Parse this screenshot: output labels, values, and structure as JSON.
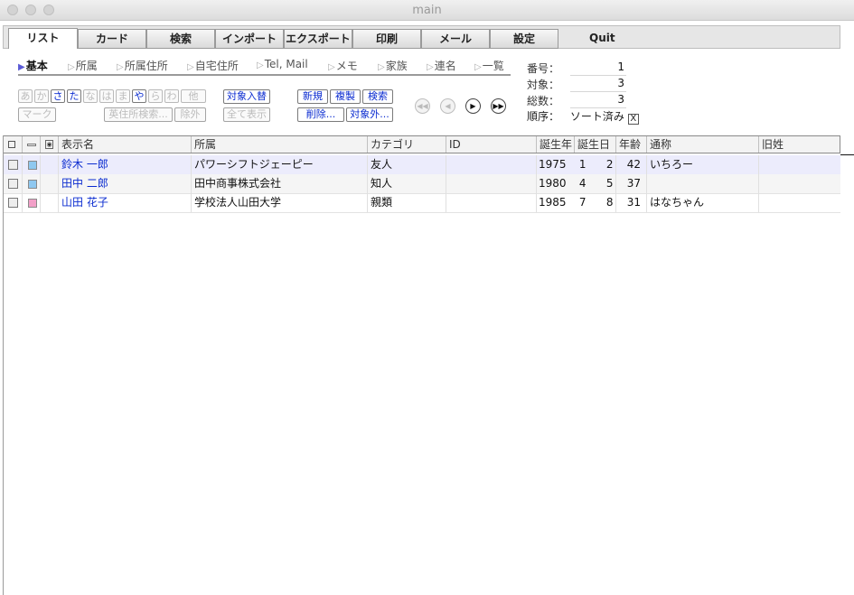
{
  "window": {
    "title": "main"
  },
  "tabs": [
    {
      "label": "リスト",
      "active": true
    },
    {
      "label": "カード"
    },
    {
      "label": "検索"
    },
    {
      "label": "インポート"
    },
    {
      "label": "エクスポート"
    },
    {
      "label": "印刷"
    },
    {
      "label": "メール"
    },
    {
      "label": "設定"
    }
  ],
  "quit_label": "Quit",
  "subtabs": [
    {
      "label": "基本",
      "active": true
    },
    {
      "label": "所属"
    },
    {
      "label": "所属住所"
    },
    {
      "label": "自宅住所"
    },
    {
      "label": "Tel, Mail"
    },
    {
      "label": "メモ"
    },
    {
      "label": "家族"
    },
    {
      "label": "連名"
    },
    {
      "label": "一覧"
    }
  ],
  "kana": [
    {
      "label": "あ",
      "enabled": false
    },
    {
      "label": "か",
      "enabled": false
    },
    {
      "label": "さ",
      "enabled": true
    },
    {
      "label": "た",
      "enabled": true
    },
    {
      "label": "な",
      "enabled": false
    },
    {
      "label": "は",
      "enabled": false
    },
    {
      "label": "ま",
      "enabled": false
    },
    {
      "label": "や",
      "enabled": true
    },
    {
      "label": "ら",
      "enabled": false
    },
    {
      "label": "わ",
      "enabled": false
    },
    {
      "label": "他",
      "enabled": false
    }
  ],
  "buttons": {
    "mark": "マーク",
    "eng_search": "英住所検索...",
    "exclude": "除外",
    "swap_target": "対象入替",
    "show_all": "全て表示",
    "new": "新規",
    "duplicate": "複製",
    "search": "検索",
    "delete": "削除...",
    "out_of_target": "対象外..."
  },
  "info": {
    "number_label": "番号：",
    "number_value": "1",
    "target_label": "対象：",
    "target_value": "3",
    "total_label": "総数：",
    "total_value": "3",
    "order_label": "順序：",
    "order_value": "ソート済み",
    "order_checked": "X"
  },
  "columns": [
    "表示名",
    "所属",
    "カテゴリ",
    "ID",
    "誕生年",
    "誕生日",
    "年齢",
    "通称",
    "旧姓"
  ],
  "rows": [
    {
      "name": "鈴木 一郎",
      "org": "パワーシフトジェーピー",
      "category": "友人",
      "id": "",
      "year": "1975",
      "month": "1",
      "day": "2",
      "age": "42",
      "nickname": "いちろー",
      "maiden": "",
      "color": "#8fc8f0",
      "highlight": true
    },
    {
      "name": "田中 二郎",
      "org": "田中商事株式会社",
      "category": "知人",
      "id": "",
      "year": "1980",
      "month": "4",
      "day": "5",
      "age": "37",
      "nickname": "",
      "maiden": "",
      "color": "#8fc8f0",
      "highlight": false
    },
    {
      "name": "山田 花子",
      "org": "学校法人山田大学",
      "category": "親類",
      "id": "",
      "year": "1985",
      "month": "7",
      "day": "8",
      "age": "31",
      "nickname": "はなちゃん",
      "maiden": "",
      "color": "#f2a0c8",
      "highlight": false
    }
  ]
}
